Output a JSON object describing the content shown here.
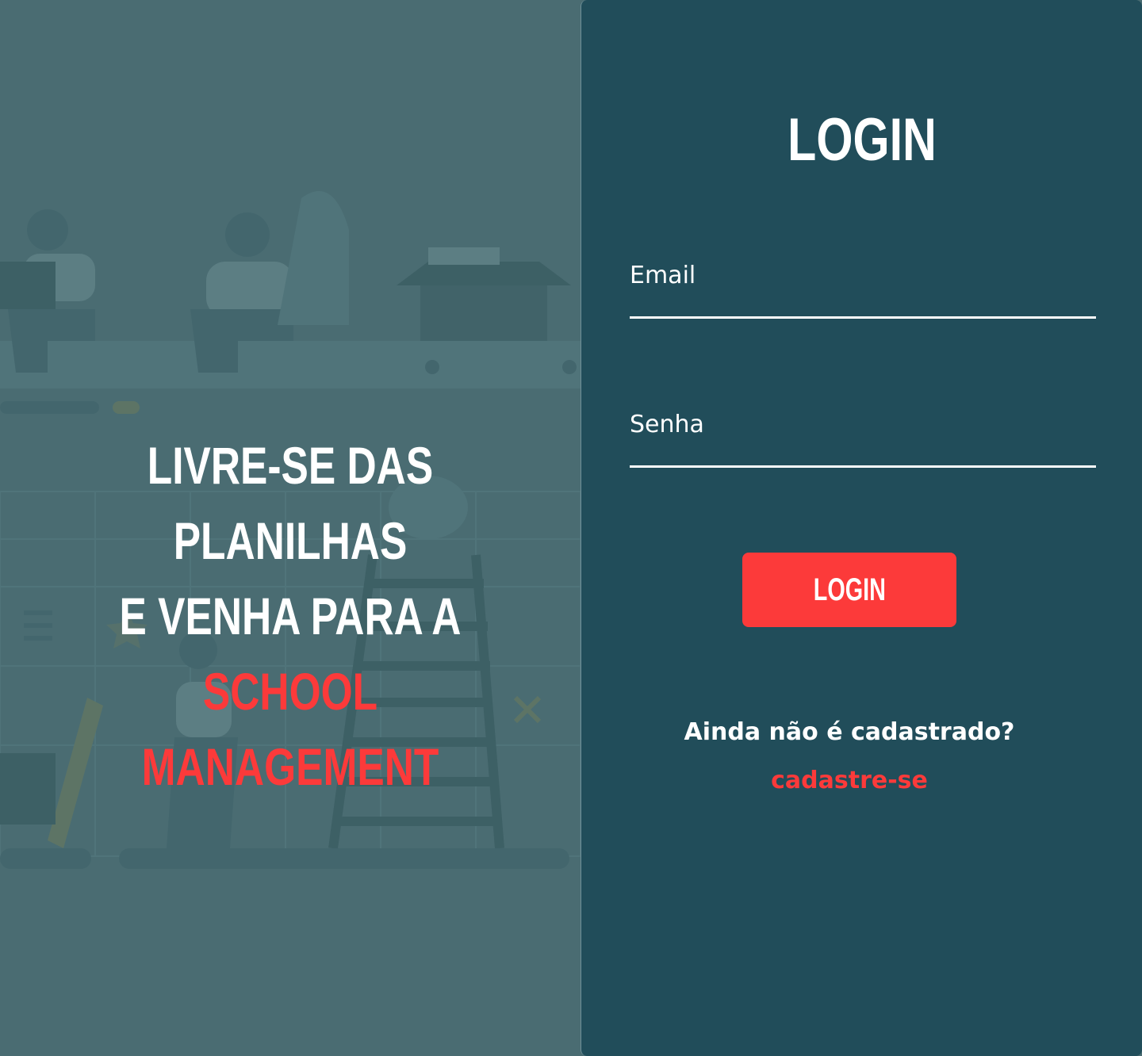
{
  "hero": {
    "line1": "LIVRE-SE DAS PLANILHAS",
    "line2_prefix": "E VENHA PARA A ",
    "line2_accent": "SCHOOL",
    "line3_accent": "MANAGEMENT"
  },
  "login_form": {
    "title": "LOGIN",
    "email_label": "Email",
    "email_value": "",
    "password_label": "Senha",
    "password_value": "",
    "submit_label": "LOGIN",
    "signup_prompt": "Ainda não é cadastrado?",
    "signup_link": "cadastre-se"
  },
  "colors": {
    "hero_background": "#4a6c72",
    "panel_background": "#214d5a",
    "accent": "#fc3a3a",
    "text": "#ffffff"
  }
}
